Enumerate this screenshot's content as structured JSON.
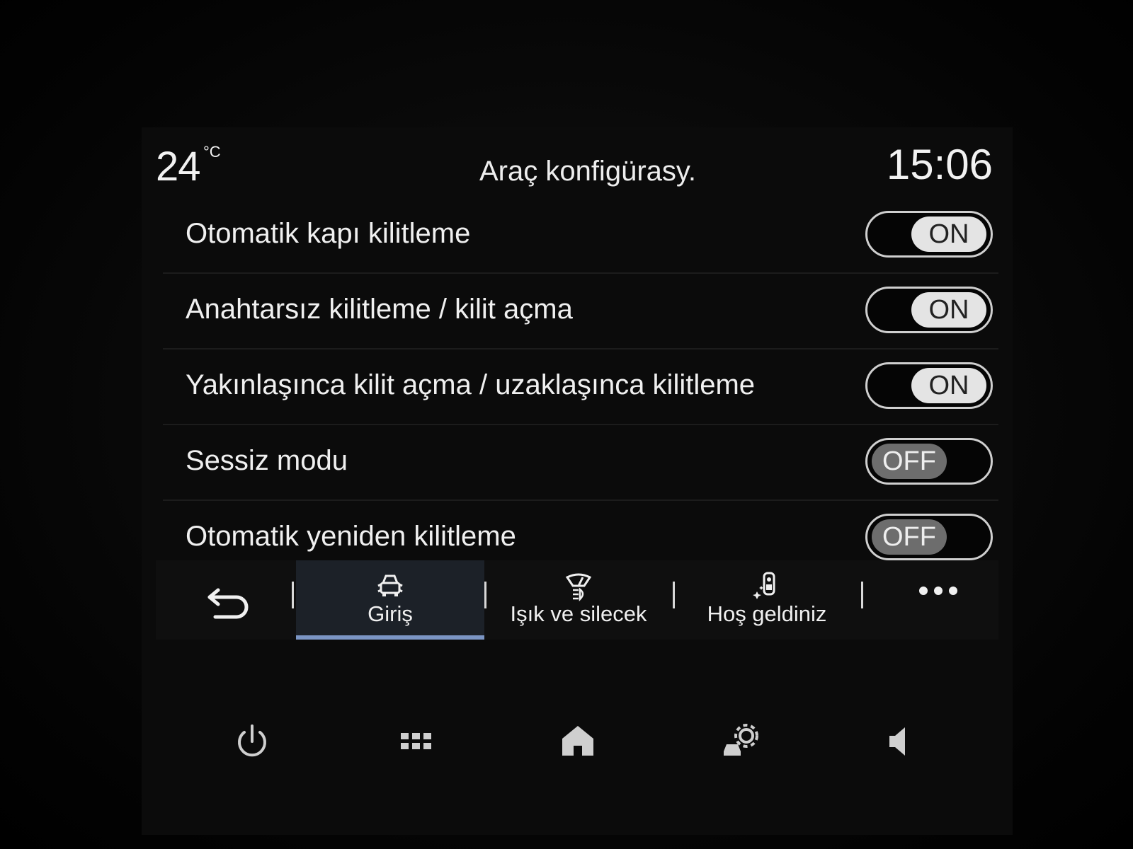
{
  "header": {
    "temperature": "24",
    "temperature_unit": "°C",
    "title": "Araç konfigürasy.",
    "clock": "15:06"
  },
  "settings": [
    {
      "label": "Otomatik kapı kilitleme",
      "state": "ON"
    },
    {
      "label": "Anahtarsız kilitleme / kilit açma",
      "state": "ON"
    },
    {
      "label": "Yakınlaşınca kilit açma / uzaklaşınca kilitleme",
      "state": "ON"
    },
    {
      "label": "Sessiz modu",
      "state": "OFF"
    },
    {
      "label": "Otomatik yeniden kilitleme",
      "state": "OFF"
    }
  ],
  "tabs": [
    {
      "label": "Giriş",
      "icon": "car-doors-icon",
      "active": true
    },
    {
      "label": "Işık ve silecek",
      "icon": "light-wiper-icon",
      "active": false
    },
    {
      "label": "Hoş geldiniz",
      "icon": "welcome-driver-icon",
      "active": false
    }
  ],
  "tabbar_icons": {
    "back": "back-arrow-icon",
    "more": "more-dots-icon"
  },
  "system_bar": [
    {
      "icon": "power-icon"
    },
    {
      "icon": "apps-grid-icon"
    },
    {
      "icon": "home-icon"
    },
    {
      "icon": "vehicle-settings-icon"
    },
    {
      "icon": "volume-icon"
    }
  ],
  "colors": {
    "active_tab_underline": "#7b95c4",
    "toggle_on_knob": "#e4e4e4",
    "toggle_off_knob": "#6d6d6d"
  }
}
